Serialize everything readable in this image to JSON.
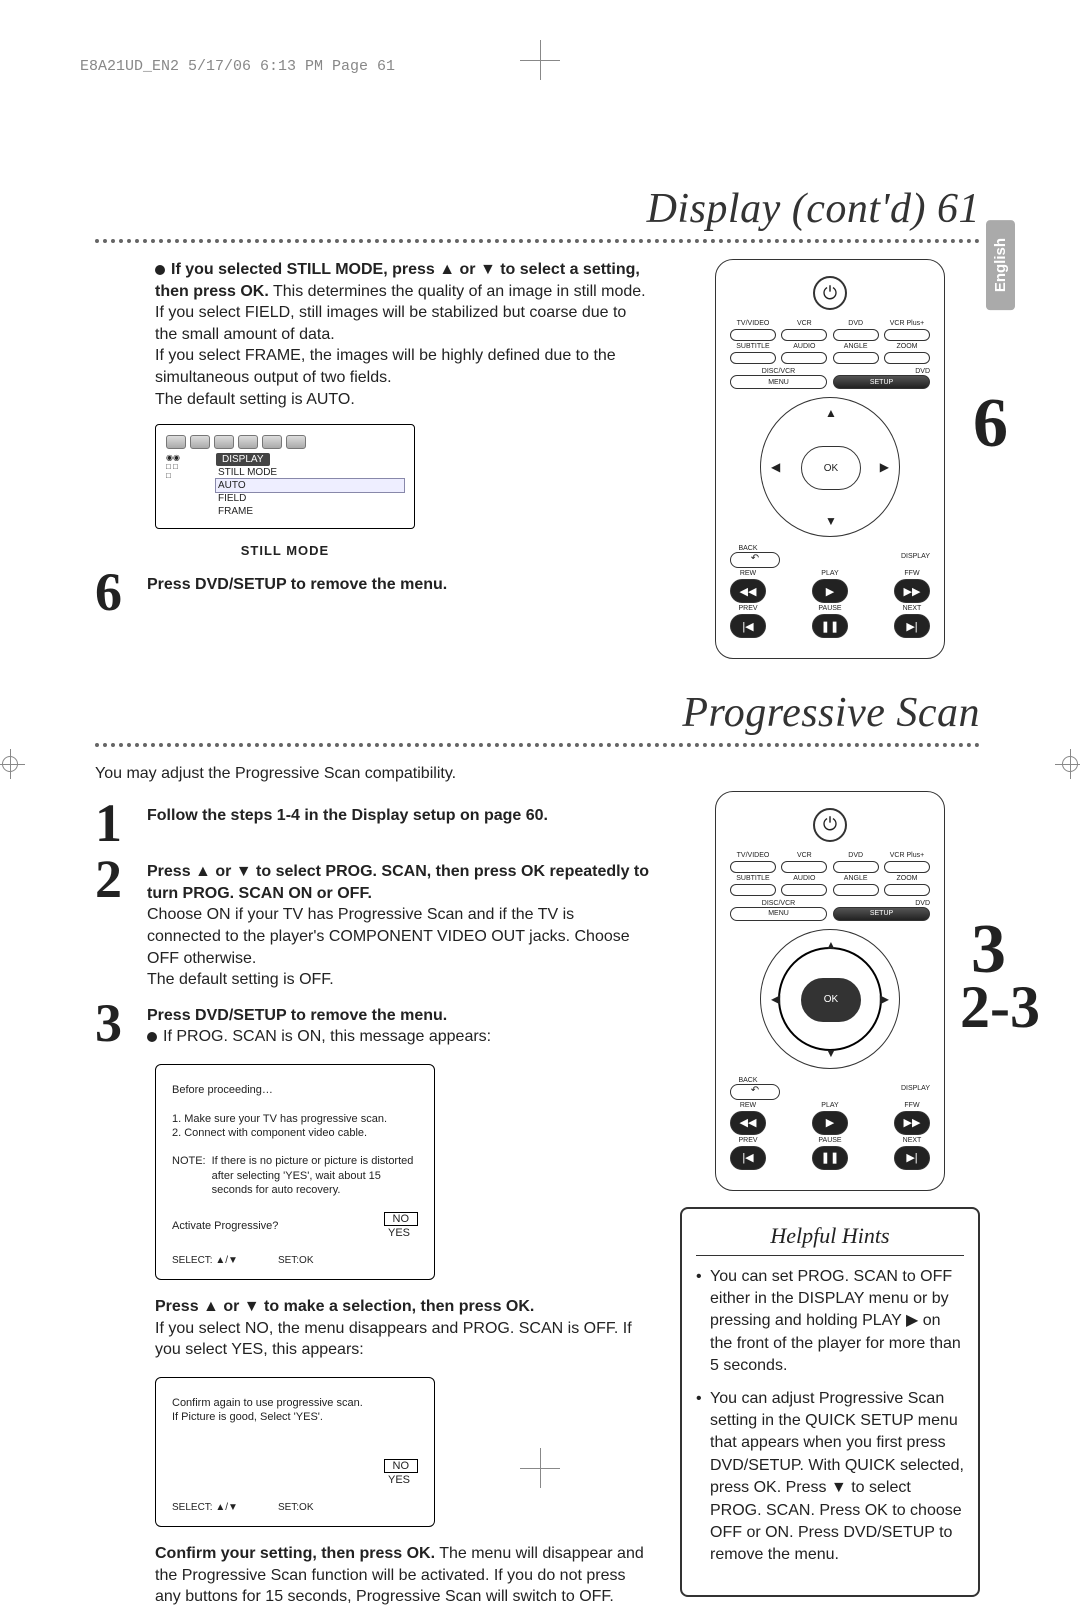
{
  "header_slug": "E8A21UD_EN2  5/17/06  6:13 PM  Page 61",
  "lang_tab": "English",
  "title1": "Display (cont'd)",
  "page_number": "61",
  "still": {
    "lead_bold1": "If you selected STILL MODE, press ▲ or ▼ to select a setting, then press OK.",
    "lead_rest1": " This determines the quality of an image in still mode.",
    "line2": "If you select FIELD, still images will be stabilized but coarse due to the small amount of data.",
    "line3": "If you select FRAME, the images will be highly defined due to the simultaneous output of two fields.",
    "line4": "The default setting is AUTO.",
    "osd_header": "DISPLAY",
    "osd_item_title": "STILL MODE",
    "osd_opts": [
      "AUTO",
      "FIELD",
      "FRAME"
    ],
    "osd_caption": "STILL MODE",
    "step6_num": "6",
    "step6_text": "Press DVD/SETUP to remove the menu."
  },
  "remote1": {
    "labels_top": [
      "TV/VIDEO",
      "VCR",
      "DVD",
      "VCR Plus+"
    ],
    "labels_mid": [
      "SUBTITLE",
      "AUDIO",
      "ANGLE",
      "ZOOM"
    ],
    "disc_vcr": "DISC/VCR",
    "menu": "MENU",
    "dvd": "DVD",
    "setup": "SETUP",
    "ok": "OK",
    "back": "BACK",
    "display": "DISPLAY",
    "rew": "REW",
    "play": "PLAY",
    "ffw": "FFW",
    "prev": "PREV",
    "pause": "PAUSE",
    "next": "NEXT",
    "callout": "6"
  },
  "title2": "Progressive Scan",
  "prog_intro": "You may adjust the Progressive Scan compatibility.",
  "prog_steps": {
    "s1_num": "1",
    "s1": "Follow the steps 1-4 in the Display setup on page 60.",
    "s2_num": "2",
    "s2_bold": "Press ▲ or ▼ to select PROG. SCAN, then press OK repeatedly to turn PROG. SCAN ON or OFF.",
    "s2_rest": "Choose ON if your TV has Progressive Scan and if the TV is connected to the player's COMPONENT VIDEO OUT jacks. Choose OFF otherwise.\nThe default setting is OFF.",
    "s3_num": "3",
    "s3_bold": "Press DVD/SETUP to remove the menu.",
    "s3_bullet": "If PROG. SCAN is ON, this message appears:"
  },
  "dialog1": {
    "heading": "Before proceeding…",
    "l1": "1. Make sure your TV has progressive scan.",
    "l2": "2. Connect with component video cable.",
    "note_label": "NOTE:",
    "note_body": "If there is no picture or picture is distorted after selecting 'YES', wait about 15 seconds for auto recovery.",
    "prompt": "Activate Progressive?",
    "opt_no": "NO",
    "opt_yes": "YES",
    "select": "SELECT: ▲/▼",
    "set": "SET:OK"
  },
  "after1_bold": "Press ▲ or ▼ to make a selection, then press OK.",
  "after1_rest": "If you select NO, the menu disappears and PROG. SCAN is OFF. If you select YES, this appears:",
  "dialog2": {
    "l1": "Confirm again to use progressive scan.",
    "l2": "If Picture is good, Select 'YES'.",
    "opt_no": "NO",
    "opt_yes": "YES",
    "select": "SELECT: ▲/▼",
    "set": "SET:OK"
  },
  "after2_bold": "Confirm your setting, then press OK.",
  "after2_rest": " The menu will disappear and the Progressive Scan function will be activated. If you do not press any buttons for 15 seconds, Progressive Scan will switch to OFF.",
  "remote2": {
    "callout_a": "3",
    "callout_b": "2-3"
  },
  "hints": {
    "title": "Helpful Hints",
    "item1": "You can set PROG. SCAN to OFF either in the DISPLAY menu or by pressing and holding PLAY ▶ on the front of the player for more than 5 seconds.",
    "item2": "You can adjust Progressive Scan setting in the QUICK SETUP menu that appears when you first press DVD/SETUP. With QUICK selected, press OK. Press ▼ to select PROG. SCAN. Press OK to choose OFF or ON. Press DVD/SETUP to remove the menu."
  }
}
